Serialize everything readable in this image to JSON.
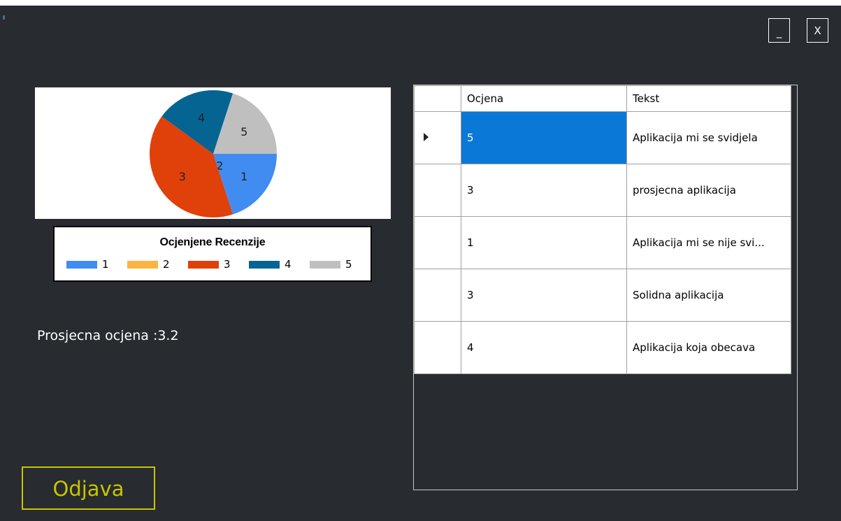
{
  "window": {
    "minimize_label": "_",
    "close_label": "X"
  },
  "chart_data": {
    "type": "pie",
    "title": "Ocjenjene Recenzije",
    "legend_position": "bottom",
    "categories": [
      "1",
      "2",
      "3",
      "4",
      "5"
    ],
    "values": [
      1,
      0,
      2,
      1,
      1
    ],
    "colors": [
      "#418cf0",
      "#fcb441",
      "#e0400a",
      "#056492",
      "#bfbfbf"
    ],
    "slice_labels": [
      "1",
      "2",
      "3",
      "4",
      "5"
    ]
  },
  "average": {
    "text": "Prosjecna ocjena :3.2"
  },
  "logout": {
    "label": "Odjava"
  },
  "grid": {
    "columns": [
      "Ocjena",
      "Tekst"
    ],
    "rows": [
      {
        "ocjena": "5",
        "tekst": "Aplikacija mi se svidjela",
        "selected": true
      },
      {
        "ocjena": "3",
        "tekst": "prosjecna aplikacija",
        "selected": false
      },
      {
        "ocjena": "1",
        "tekst": "Aplikacija mi se nije svi...",
        "selected": false
      },
      {
        "ocjena": "3",
        "tekst": "Solidna aplikacija",
        "selected": false
      },
      {
        "ocjena": "4",
        "tekst": "Aplikacija koja obecava",
        "selected": false
      }
    ]
  }
}
